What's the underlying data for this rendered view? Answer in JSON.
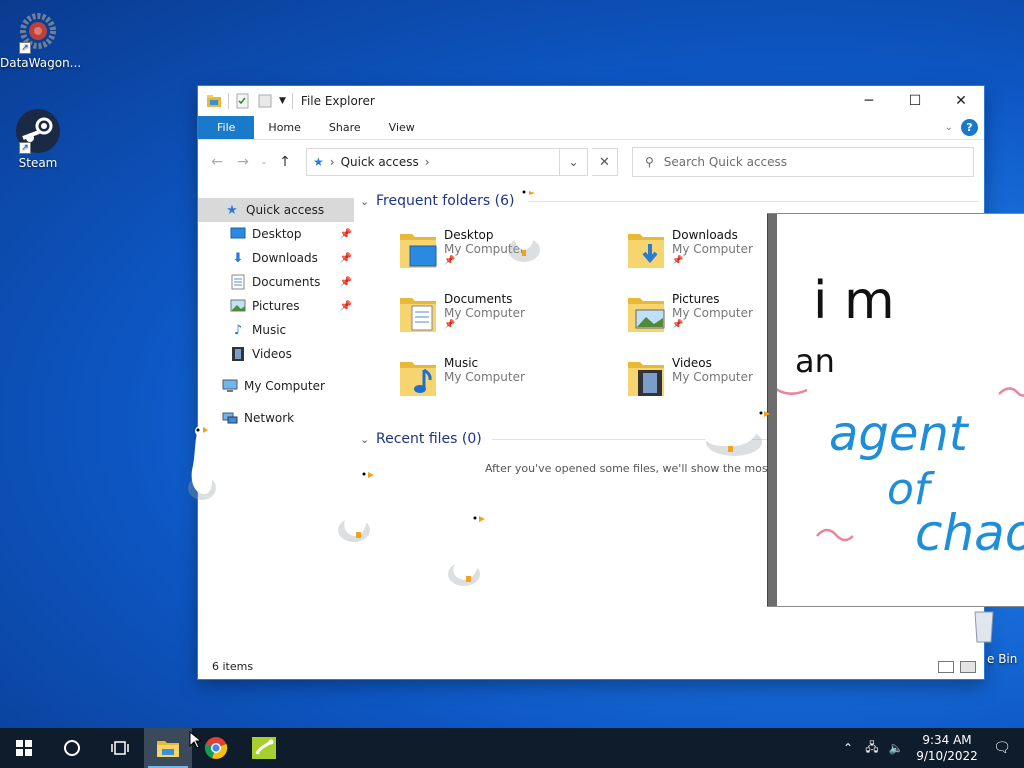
{
  "desktop": {
    "icons": [
      {
        "label": "DataWagon..."
      },
      {
        "label": "Steam"
      }
    ],
    "recycle_label": "e Bin"
  },
  "window": {
    "title": "File Explorer",
    "controls": {
      "minimize": "─",
      "maximize": "☐",
      "close": "✕"
    },
    "ribbon_tabs": [
      "File",
      "Home",
      "Share",
      "View"
    ],
    "address": {
      "path": "Quick access"
    },
    "search": {
      "placeholder": "Search Quick access"
    },
    "nav": [
      {
        "label": "Quick access",
        "selected": true
      },
      {
        "label": "Desktop",
        "pinned": true
      },
      {
        "label": "Downloads",
        "pinned": true
      },
      {
        "label": "Documents",
        "pinned": true
      },
      {
        "label": "Pictures",
        "pinned": true
      },
      {
        "label": "Music"
      },
      {
        "label": "Videos"
      },
      {
        "label": "My Computer"
      },
      {
        "label": "Network"
      }
    ],
    "frequent_header": "Frequent folders (6)",
    "recent_header": "Recent files (0)",
    "folders": [
      {
        "name": "Desktop",
        "location": "My Computer",
        "pinned": true
      },
      {
        "name": "Downloads",
        "location": "My Computer",
        "pinned": true
      },
      {
        "name": "Documents",
        "location": "My Computer",
        "pinned": true
      },
      {
        "name": "Pictures",
        "location": "My Computer",
        "pinned": true
      },
      {
        "name": "Music",
        "location": "My Computer"
      },
      {
        "name": "Videos",
        "location": "My Computer"
      }
    ],
    "recent_empty_message": "After you've opened some files, we'll show the most r",
    "status": "6 items"
  },
  "paint_note": {
    "line1": "i m",
    "line2": "an",
    "line3": "agent",
    "line4": "of",
    "line5": "chao"
  },
  "taskbar": {
    "time": "9:34 AM",
    "date": "9/10/2022"
  },
  "colors": {
    "accent": "#1979ca",
    "group_header": "#1e3287",
    "taskbar": "#0f1c2b"
  }
}
